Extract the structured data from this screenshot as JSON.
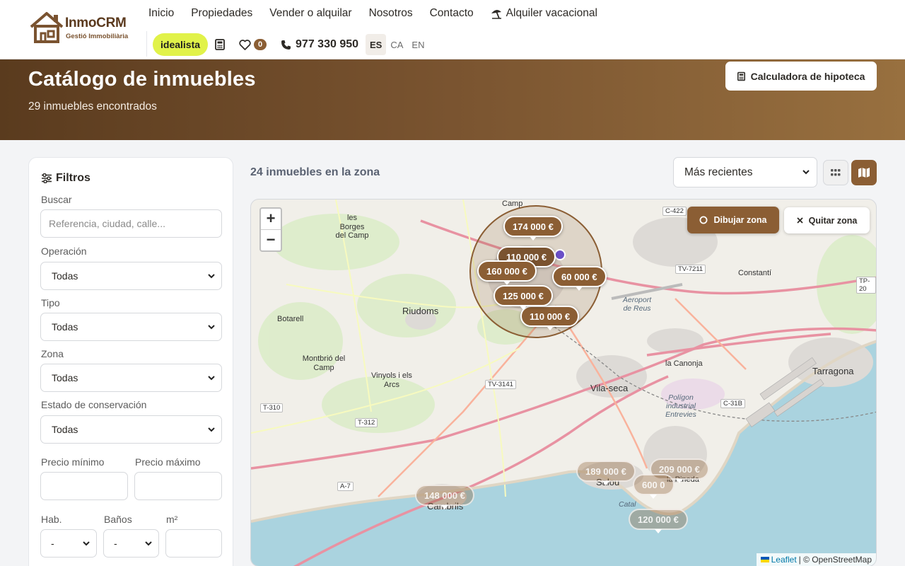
{
  "header": {
    "logo_name": "InmoCRM",
    "logo_sub": "Gestió Immobiliària",
    "nav": [
      {
        "label": "Inicio"
      },
      {
        "label": "Propiedades"
      },
      {
        "label": "Vender o alquilar"
      },
      {
        "label": "Nosotros"
      },
      {
        "label": "Contacto"
      },
      {
        "label": "Alquiler vacacional",
        "icon": "umbrella-beach-icon"
      }
    ],
    "idealista": "idealista",
    "favorites_count": "0",
    "phone": "977 330 950",
    "languages": [
      {
        "code": "ES",
        "active": true
      },
      {
        "code": "CA",
        "active": false
      },
      {
        "code": "EN",
        "active": false
      }
    ]
  },
  "hero": {
    "title": "Catálogo de inmuebles",
    "count": "29 inmuebles encontrados",
    "mortgage_button": "Calculadora de hipoteca"
  },
  "filters": {
    "title": "Filtros",
    "search_label": "Buscar",
    "search_placeholder": "Referencia, ciudad, calle...",
    "operation_label": "Operación",
    "operation_value": "Todas",
    "type_label": "Tipo",
    "type_value": "Todas",
    "zone_label": "Zona",
    "zone_value": "Todas",
    "condition_label": "Estado de conservación",
    "condition_value": "Todas",
    "min_price_label": "Precio mínimo",
    "max_price_label": "Precio máximo",
    "rooms_label": "Hab.",
    "rooms_value": "-",
    "baths_label": "Baños",
    "baths_value": "-",
    "area_label": "m²"
  },
  "results": {
    "zone_count": "24 inmuebles en la zona",
    "sort_value": "Más recientes"
  },
  "map": {
    "draw_button": "Dibujar zona",
    "clear_button": "Quitar zona",
    "zoom_in": "+",
    "zoom_out": "−",
    "attribution_leaflet": "Leaflet",
    "attribution_osm": "| © OpenStreetMap",
    "price_markers": [
      {
        "label": "174 000 €",
        "faded": false
      },
      {
        "label": "110 000 €",
        "faded": false
      },
      {
        "label": "160 000 €",
        "faded": false
      },
      {
        "label": "60 000 €",
        "faded": false
      },
      {
        "label": "125 000 €",
        "faded": false
      },
      {
        "label": "110 000 €",
        "faded": false
      },
      {
        "label": "189 000 €",
        "faded": true
      },
      {
        "label": "209 000 €",
        "faded": true
      },
      {
        "label": "148 000 €",
        "faded": true
      },
      {
        "label": "600 0",
        "faded": true
      },
      {
        "label": "120 000 €",
        "faded": true
      }
    ],
    "places": [
      "les Borges del Camp",
      "Riudoms",
      "Botarell",
      "Montbrió del Camp",
      "Vinyols i els Arcs",
      "Vila-seca",
      "la Canonja",
      "Tarragona",
      "Constantí",
      "Salou",
      "Cambrils",
      "la Pineda",
      "Camp"
    ],
    "italic_places": [
      "Aeroport de Reus",
      "Polígon industrial Entrevies",
      "Catal"
    ],
    "roads": [
      "C-422",
      "TV-7211",
      "TP-20",
      "TV-3141",
      "T-310",
      "T-312",
      "A-7",
      "C-31B"
    ]
  }
}
